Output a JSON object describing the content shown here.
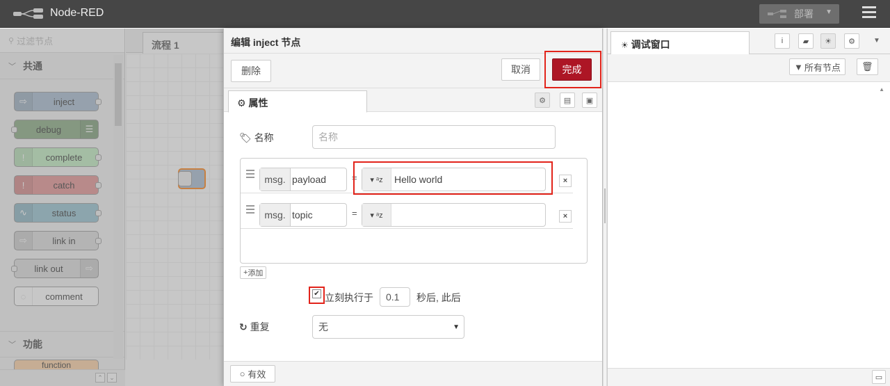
{
  "header": {
    "app_title": "Node-RED",
    "deploy_label": "部署",
    "accent_color": "#464646"
  },
  "palette": {
    "search_placeholder": "过滤节点",
    "category_common": "共通",
    "category_function": "功能",
    "nodes": [
      {
        "label": "inject",
        "color": "#a6bbcf"
      },
      {
        "label": "debug",
        "color": "#87a980"
      },
      {
        "label": "complete",
        "color": "#c0edc0"
      },
      {
        "label": "catch",
        "color": "#e49191"
      },
      {
        "label": "status",
        "color": "#94c1d0"
      },
      {
        "label": "link in",
        "color": "#dddddd"
      },
      {
        "label": "link out",
        "color": "#dddddd"
      },
      {
        "label": "comment",
        "color": "#ffffff"
      }
    ],
    "next_node_partial": "function"
  },
  "workspace": {
    "tab_label": "流程 1"
  },
  "editor": {
    "title": "编辑 inject 节点",
    "delete_label": "删除",
    "cancel_label": "取消",
    "done_label": "完成",
    "tab_properties": "属性",
    "name_label": "名称",
    "name_placeholder": "名称",
    "props": [
      {
        "prefix": "msg.",
        "key": "payload",
        "type_icon": "az",
        "value": "Hello world"
      },
      {
        "prefix": "msg.",
        "key": "topic",
        "type_icon": "az",
        "value": ""
      }
    ],
    "equals": "=",
    "add_label": "添加",
    "inject_once_label": "立刻执行于",
    "inject_once_checked": true,
    "inject_once_delay": "0.1",
    "inject_once_suffix": "秒后, 此后",
    "repeat_label": "重复",
    "repeat_value": "无",
    "enabled_label": "有效"
  },
  "sidebar": {
    "tab_label": "调试窗口",
    "filter_label": "所有节点"
  }
}
